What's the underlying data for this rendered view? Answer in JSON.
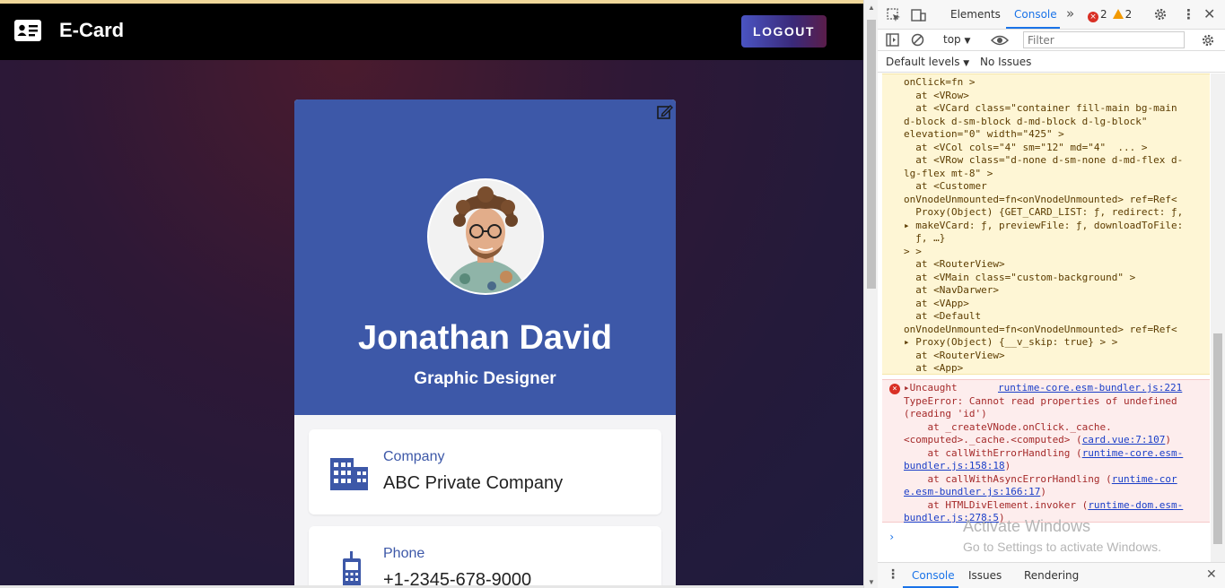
{
  "app": {
    "title": "E-Card",
    "logout_label": "LOGOUT",
    "colors": {
      "header": "#3d58a8",
      "accent": "#3d58a8"
    }
  },
  "card": {
    "name": "Jonathan David",
    "job_title": "Graphic Designer",
    "fields": [
      {
        "label": "Company",
        "value": "ABC Private Company",
        "icon": "building-icon"
      },
      {
        "label": "Phone",
        "value": "+1-2345-678-9000",
        "icon": "phone-icon"
      }
    ]
  },
  "devtools": {
    "tabs": [
      "Elements",
      "Console"
    ],
    "active_tab": "Console",
    "error_count": "2",
    "warning_count": "2",
    "context": "top",
    "filter_placeholder": "Filter",
    "levels_label": "Default levels",
    "issues_label": "No Issues",
    "warning_lines": [
      "onClick=fn >",
      "  at <VRow>",
      "  at <VCard class=\"container fill-main bg-main",
      "d-block d-sm-block d-md-block d-lg-block\"",
      "elevation=\"0\" width=\"425\" >",
      "  at <VCol cols=\"4\" sm=\"12\" md=\"4\"  ... >",
      "  at <VRow class=\"d-none d-sm-none d-md-flex d-",
      "lg-flex mt-8\" >",
      "  at <Customer",
      "onVnodeUnmounted=fn<onVnodeUnmounted> ref=Ref<",
      "  Proxy(Object) {GET_CARD_LIST: ƒ, redirect: ƒ,",
      "▸ makeVCard: ƒ, previewFile: ƒ, downloadToFile:",
      "  ƒ, …}",
      "> >",
      "  at <RouterView>",
      "  at <VMain class=\"custom-background\" >",
      "  at <NavDarwer>",
      "  at <VApp>",
      "  at <Default",
      "onVnodeUnmounted=fn<onVnodeUnmounted> ref=Ref<",
      "▸ Proxy(Object) {__v_skip: true} > >",
      "  at <RouterView>",
      "  at <App>"
    ],
    "error": {
      "head": "▸Uncaught",
      "source": "runtime-core.esm-bundler.js:221",
      "lines": [
        {
          "text": "TypeError: Cannot read properties of undefined",
          "link": ""
        },
        {
          "text": "(reading 'id')",
          "link": ""
        },
        {
          "text": "    at _createVNode.onClick._cache.",
          "link": ""
        },
        {
          "text": "<computed>._cache.<computed> (",
          "link": "card.vue:7:107",
          "after": ")"
        },
        {
          "text": "    at callWithErrorHandling (",
          "link": "runtime-core.esm-",
          "after": ""
        },
        {
          "text": "",
          "link": "bundler.js:158:18",
          "after": ")"
        },
        {
          "text": "    at callWithAsyncErrorHandling (",
          "link": "runtime-cor",
          "after": ""
        },
        {
          "text": "",
          "link": "e.esm-bundler.js:166:17",
          "after": ")"
        },
        {
          "text": "    at HTMLDivElement.invoker (",
          "link": "runtime-dom.esm-",
          "after": ""
        },
        {
          "text": "",
          "link": "bundler.js:278:5",
          "after": ")"
        }
      ]
    },
    "watermark_title": "Activate Windows",
    "watermark_sub": "Go to Settings to activate Windows.",
    "drawer_tabs": [
      "Console",
      "Issues",
      "Rendering"
    ]
  }
}
